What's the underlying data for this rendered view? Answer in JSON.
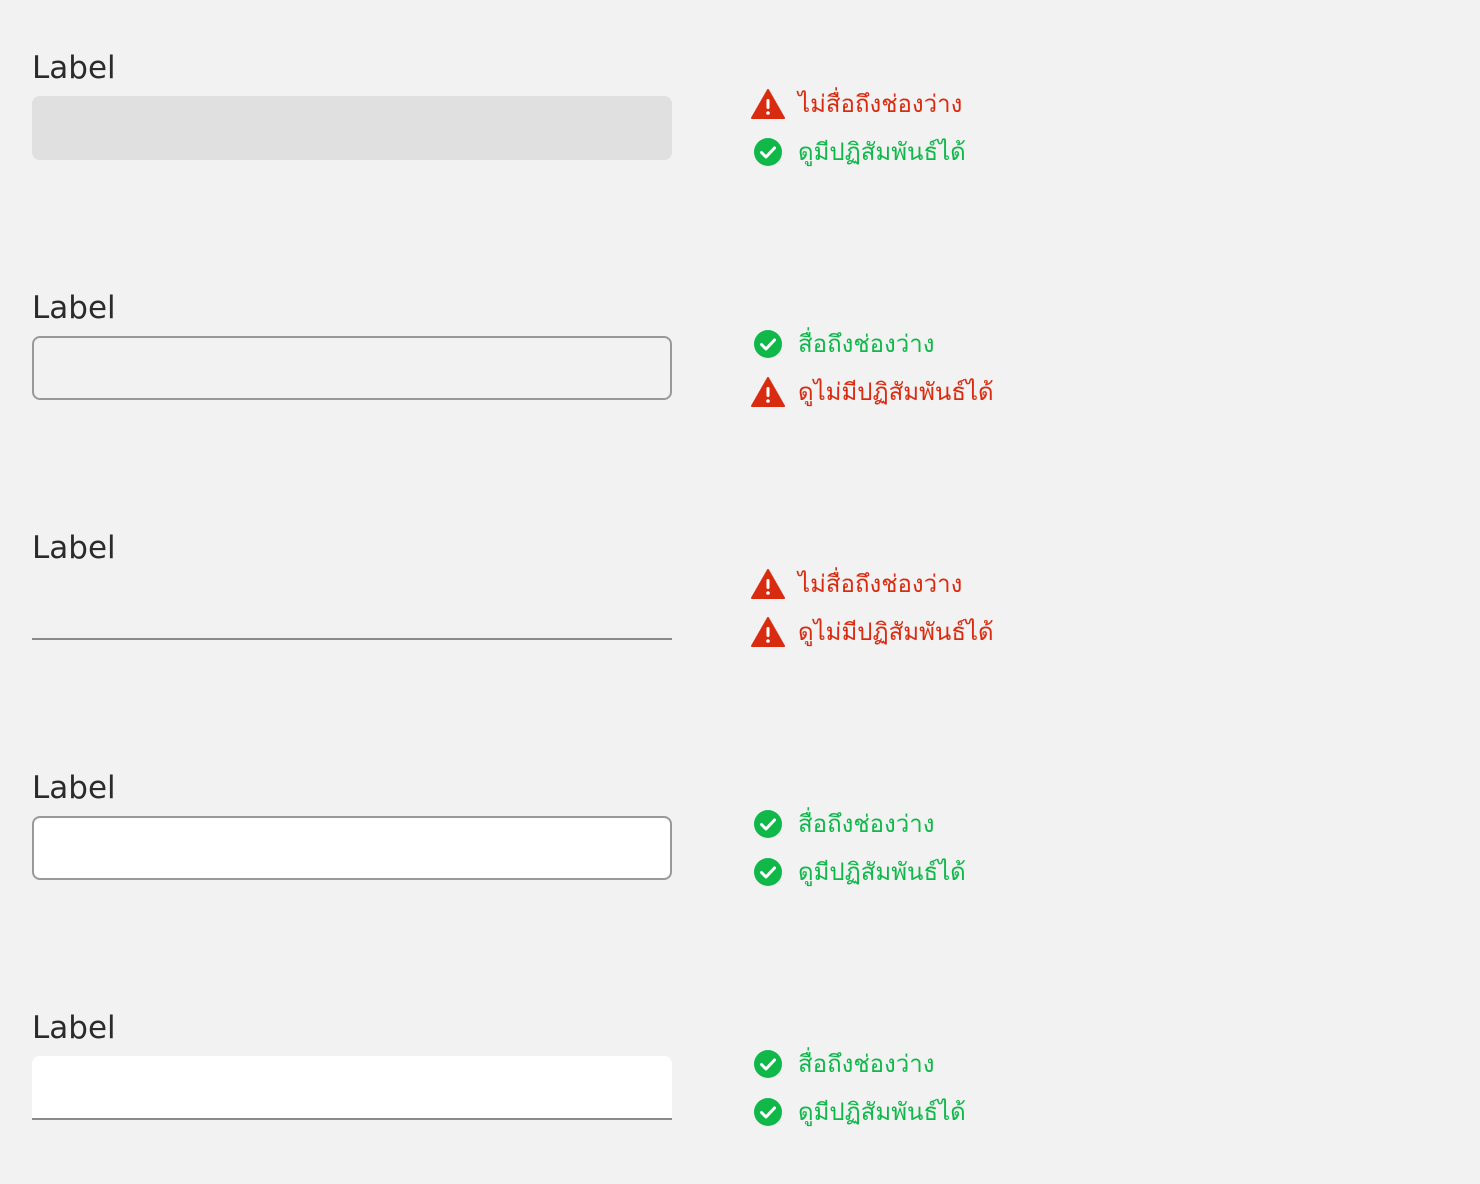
{
  "colors": {
    "background": "#f2f2f2",
    "label": "#2b2b2b",
    "fail": "#d92b10",
    "pass": "#10b84a",
    "input_border": "#999999",
    "input_filled_grey": "#e0e0e0",
    "input_filled_white": "#ffffff"
  },
  "rows": [
    {
      "label": "Label",
      "field_style": "filled-grey",
      "checks": [
        {
          "status": "fail",
          "icon": "warning-triangle-icon",
          "text": "ไม่สื่อถึงช่องว่าง"
        },
        {
          "status": "pass",
          "icon": "check-circle-icon",
          "text": "ดูมีปฏิสัมพันธ์ได้"
        }
      ]
    },
    {
      "label": "Label",
      "field_style": "outline-clear",
      "checks": [
        {
          "status": "pass",
          "icon": "check-circle-icon",
          "text": "สื่อถึงช่องว่าง"
        },
        {
          "status": "fail",
          "icon": "warning-triangle-icon",
          "text": "ดูไม่มีปฏิสัมพันธ์ได้"
        }
      ]
    },
    {
      "label": "Label",
      "field_style": "underline",
      "checks": [
        {
          "status": "fail",
          "icon": "warning-triangle-icon",
          "text": "ไม่สื่อถึงช่องว่าง"
        },
        {
          "status": "fail",
          "icon": "warning-triangle-icon",
          "text": "ดูไม่มีปฏิสัมพันธ์ได้"
        }
      ]
    },
    {
      "label": "Label",
      "field_style": "outline-white",
      "checks": [
        {
          "status": "pass",
          "icon": "check-circle-icon",
          "text": "สื่อถึงช่องว่าง"
        },
        {
          "status": "pass",
          "icon": "check-circle-icon",
          "text": "ดูมีปฏิสัมพันธ์ได้"
        }
      ]
    },
    {
      "label": "Label",
      "field_style": "filled-white",
      "checks": [
        {
          "status": "pass",
          "icon": "check-circle-icon",
          "text": "สื่อถึงช่องว่าง"
        },
        {
          "status": "pass",
          "icon": "check-circle-icon",
          "text": "ดูมีปฏิสัมพันธ์ได้"
        }
      ]
    }
  ]
}
